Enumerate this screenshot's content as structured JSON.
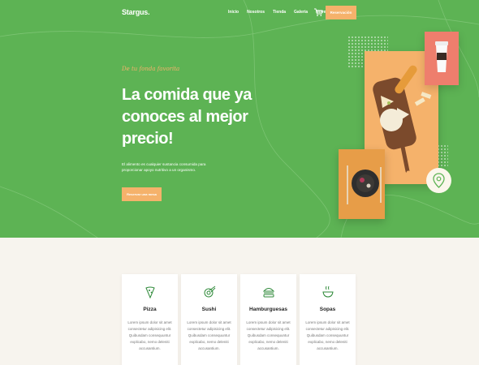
{
  "header": {
    "logo": "Stargus.",
    "nav": [
      "Inicio",
      "Nosotros",
      "Tienda",
      "Galería",
      "Novedades"
    ],
    "reserve_label": "Reservación"
  },
  "hero": {
    "tagline": "De tu fonda favorita",
    "headline": "La comida que ya conoces al mejor precio!",
    "description": "El alimento es cualquier sustancia consumida para proporcionar apoyo nutritivo a un organismo.",
    "cta_label": "Reservar una mesa"
  },
  "categories": [
    {
      "title": "Pizza",
      "icon": "pizza-icon",
      "text": "Lorem ipsum dolor sit amet consectetur adipisicing elit. Quibusdam consequuntur explicabo, nemo deleniti accusantium."
    },
    {
      "title": "Sushi",
      "icon": "sushi-icon",
      "text": "Lorem ipsum dolor sit amet consectetur adipisicing elit. Quibusdam consequuntur explicabo, nemo deleniti accusantium."
    },
    {
      "title": "Hamburguesas",
      "icon": "burger-icon",
      "text": "Lorem ipsum dolor sit amet consectetur adipisicing elit. Quibusdam consequuntur explicabo, nemo deleniti accusantium."
    },
    {
      "title": "Sopas",
      "icon": "soup-icon",
      "text": "Lorem ipsum dolor sit amet consectetur adipisicing elit. Quibusdam consequuntur explicabo, nemo deleniti accusantium."
    }
  ],
  "colors": {
    "green": "#5db354",
    "orange": "#f5b26b",
    "coral": "#ee7e6d",
    "cream": "#f7f4ee"
  }
}
